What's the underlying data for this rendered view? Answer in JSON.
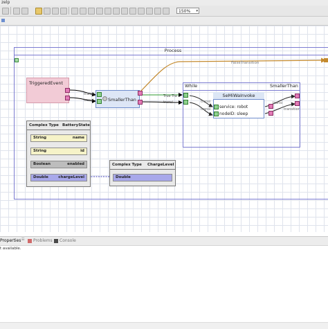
{
  "menubar": {
    "label": "zelp"
  },
  "toolbar": {
    "zoom": "150%"
  },
  "diagram": {
    "process_title": "Process",
    "false_transition": "FalseTransition",
    "true_transition": "True Tra",
    "transition_a": "transi",
    "transition_b": "transi",
    "transition_c": "transi",
    "transition_d": "transi",
    "transition_e": "transi",
    "transition_f": "transi",
    "transition_g": "transition",
    "triggered_event": "TriggeredEvent",
    "smaller_than": "SmallerThan",
    "while_label": "While",
    "while_right": "SmallerThan",
    "semi_title": "SeMiWaInvoke",
    "semi_service": "service: robot",
    "semi_node": "nodeID: sleep"
  },
  "battery": {
    "head_left": "Complex Type",
    "head_right": "BatteryState",
    "fields": [
      {
        "type": "String",
        "name": "name",
        "color": "#f6f3c8"
      },
      {
        "type": "String",
        "name": "id",
        "color": "#f6f3c8"
      },
      {
        "type": "Boolean",
        "name": "enabled",
        "color": "#bdbdbd"
      },
      {
        "type": "Double",
        "name": "chargeLevel",
        "color": "#a8a8ea"
      }
    ]
  },
  "charge": {
    "head_left": "Complex Type",
    "head_right": "ChargeLevel",
    "field_type": "Double",
    "field_color": "#a8a8ea"
  },
  "bottom_tabs": {
    "properties": "Properties",
    "problems": "Problems",
    "console": "Console"
  },
  "status": "t available."
}
